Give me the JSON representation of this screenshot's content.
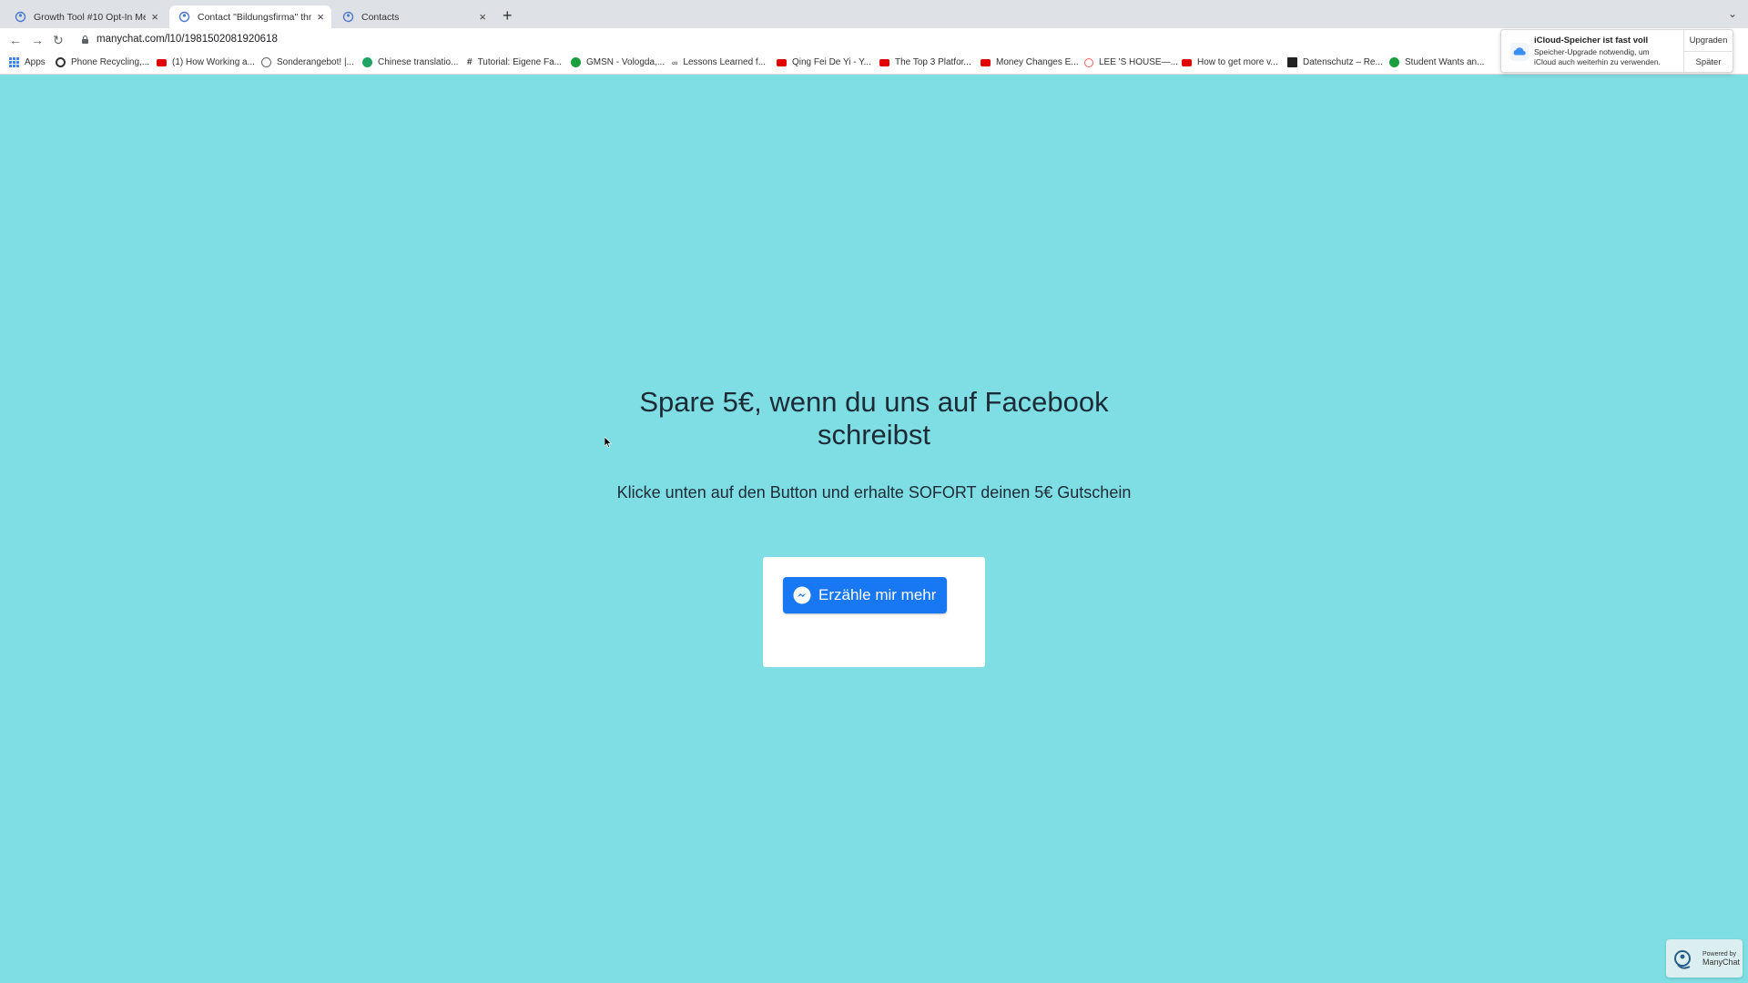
{
  "browser": {
    "tabs": [
      {
        "title": "Growth Tool #10 Opt-In Messa",
        "icon": "manychat-icon"
      },
      {
        "title": "Contact \"Bildungsfirma\" throu",
        "icon": "manychat-icon"
      },
      {
        "title": "Contacts",
        "icon": "manychat-icon"
      }
    ],
    "url": "manychat.com/l10/1981502081920618",
    "bookmarks": [
      {
        "label": "Apps",
        "color": "#4285f4"
      },
      {
        "label": "Phone Recycling,...",
        "color": "#333333"
      },
      {
        "label": "(1) How Working a...",
        "color": "#e00000"
      },
      {
        "label": "Sonderangebot! |...",
        "color": "#666666"
      },
      {
        "label": "Chinese translatio...",
        "color": "#21a366"
      },
      {
        "label": "Tutorial: Eigene Fa...",
        "color": "#333333"
      },
      {
        "label": "GMSN - Vologda,...",
        "color": "#1b9e3e"
      },
      {
        "label": "Lessons Learned f...",
        "color": "#444444"
      },
      {
        "label": "Qing Fei De Yi - Y...",
        "color": "#e00000"
      },
      {
        "label": "The Top 3 Platfor...",
        "color": "#e00000"
      },
      {
        "label": "Money Changes E...",
        "color": "#e00000"
      },
      {
        "label": "LEE 'S HOUSE—...",
        "color": "#ff5a5f"
      },
      {
        "label": "How to get more v...",
        "color": "#e00000"
      },
      {
        "label": "Datenschutz – Re...",
        "color": "#222222"
      },
      {
        "label": "Student Wants an...",
        "color": "#1b9e3e"
      }
    ]
  },
  "notification": {
    "title": "iCloud-Speicher ist fast voll",
    "body": "Speicher-Upgrade notwendig, um iCloud auch weiterhin zu verwenden.",
    "upgrade_label": "Upgraden",
    "later_label": "Später"
  },
  "landing": {
    "headline": "Spare 5€, wenn du uns auf Facebook schreibst",
    "subline": "Klicke unten auf den Button und erhalte SOFORT deinen 5€ Gutschein",
    "button_label": "Erzähle mir mehr"
  },
  "footer": {
    "powered_by": "Powered by",
    "brand": "ManyChat"
  },
  "colors": {
    "background": "#7fdde4",
    "messenger_button": "#1877f2"
  }
}
